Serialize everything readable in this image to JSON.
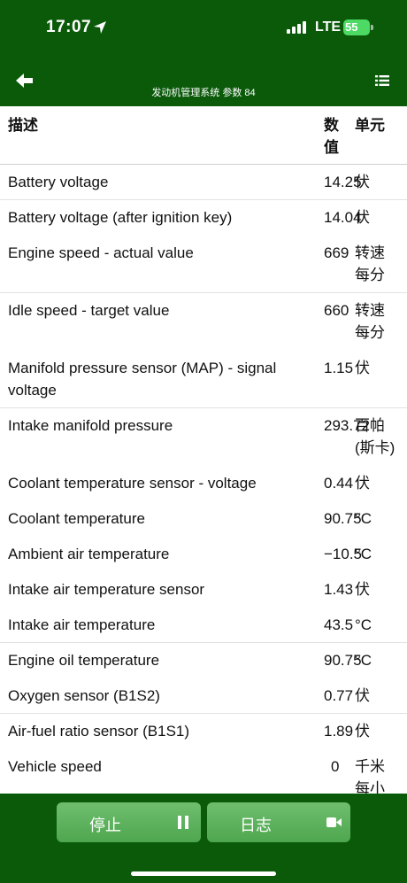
{
  "status": {
    "time": "17:07",
    "network": "LTE",
    "battery": "55"
  },
  "header": {
    "title": "发动机管理系统 参数 84"
  },
  "table": {
    "headers": {
      "description": "描述",
      "value": "数值",
      "unit": "单元"
    },
    "rows": [
      {
        "desc": "Battery voltage",
        "value": "14.25",
        "unit": "伏"
      },
      {
        "desc": "Battery voltage (after ignition key)",
        "value": "14.04",
        "unit": "伏"
      },
      {
        "desc": "Engine speed - actual value",
        "value": "669",
        "unit": "转速每分"
      },
      {
        "desc": "Idle speed - target value",
        "value": "660",
        "unit": "转速每分"
      },
      {
        "desc": "Manifold pressure sensor (MAP) - signal voltage",
        "value": "1.15",
        "unit": "伏"
      },
      {
        "desc": "Intake manifold pressure",
        "value": "293.72",
        "unit": "百帕(斯卡)"
      },
      {
        "desc": "Coolant temperature sensor - voltage",
        "value": "0.44",
        "unit": "伏"
      },
      {
        "desc": "Coolant temperature",
        "value": "90.75",
        "unit": "°C"
      },
      {
        "desc": "Ambient air temperature",
        "value": "−10.5",
        "unit": "°C"
      },
      {
        "desc": "Intake air temperature sensor",
        "value": "1.43",
        "unit": "伏"
      },
      {
        "desc": "Intake air temperature",
        "value": "43.5",
        "unit": "°C"
      },
      {
        "desc": "Engine oil temperature",
        "value": "90.75",
        "unit": "°C"
      },
      {
        "desc": "Oxygen sensor (B1S2)",
        "value": "0.77",
        "unit": "伏"
      },
      {
        "desc": "Air-fuel ratio sensor (B1S1)",
        "value": "1.89",
        "unit": "伏"
      },
      {
        "desc": "Vehicle speed",
        "value": "0",
        "unit": "千米每小时"
      }
    ]
  },
  "footer": {
    "stop_label": "停止",
    "log_label": "日志"
  },
  "colors": {
    "header_bg": "#0a5a0a",
    "button_bg": "#5fb35f",
    "battery": "#4cd964"
  },
  "icons": [
    "location-arrow-icon",
    "signal-icon",
    "battery-icon",
    "back-arrow-icon",
    "list-menu-icon",
    "pause-icon",
    "video-camera-icon"
  ]
}
